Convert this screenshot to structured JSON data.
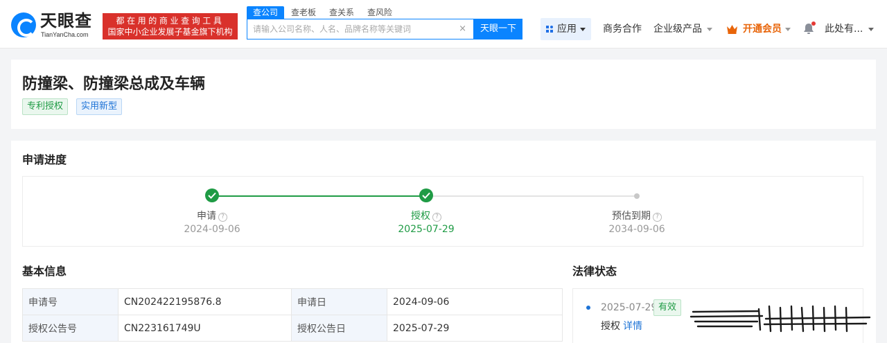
{
  "header": {
    "logo": {
      "name": "天眼查",
      "domain": "TianYanCha.com"
    },
    "slogan": {
      "line1": "都在用的商业查询工具",
      "line2": "国家中小企业发展子基金旗下机构"
    },
    "search_tabs": [
      "查公司",
      "查老板",
      "查关系",
      "查风险"
    ],
    "search": {
      "placeholder": "请输入公司名称、人名、品牌名称等关键词",
      "clear": "×",
      "button": "天眼一下"
    },
    "nav": {
      "apps": "应用",
      "business": "商务合作",
      "enterprise": "企业级产品",
      "vip": "开通会员",
      "user": "此处有..."
    }
  },
  "patent": {
    "title": "防撞梁、防撞梁总成及车辆",
    "tags": [
      "专利授权",
      "实用新型"
    ]
  },
  "progress": {
    "heading": "申请进度",
    "steps": [
      {
        "label": "申请",
        "date": "2024-09-06",
        "status": "done"
      },
      {
        "label": "授权",
        "date": "2025-07-29",
        "status": "done"
      },
      {
        "label": "预估到期",
        "date": "2034-09-06",
        "status": "pending"
      }
    ],
    "help": "?"
  },
  "basic_info": {
    "heading": "基本信息",
    "rows": [
      {
        "k1": "申请号",
        "v1": "CN202422195876.8",
        "k2": "申请日",
        "v2": "2024-09-06"
      },
      {
        "k1": "授权公告号",
        "v1": "CN223161749U",
        "k2": "授权公告日",
        "v2": "2025-07-29"
      }
    ]
  },
  "legal_status": {
    "heading": "法律状态",
    "date": "2025-07-29",
    "badge": "有效",
    "event": "授权",
    "link": "详情"
  },
  "colors": {
    "brand_blue": "#0a84ff",
    "done_green": "#1f9b45",
    "vip_orange": "#e8650a",
    "slogan_red": "#d9312b"
  }
}
